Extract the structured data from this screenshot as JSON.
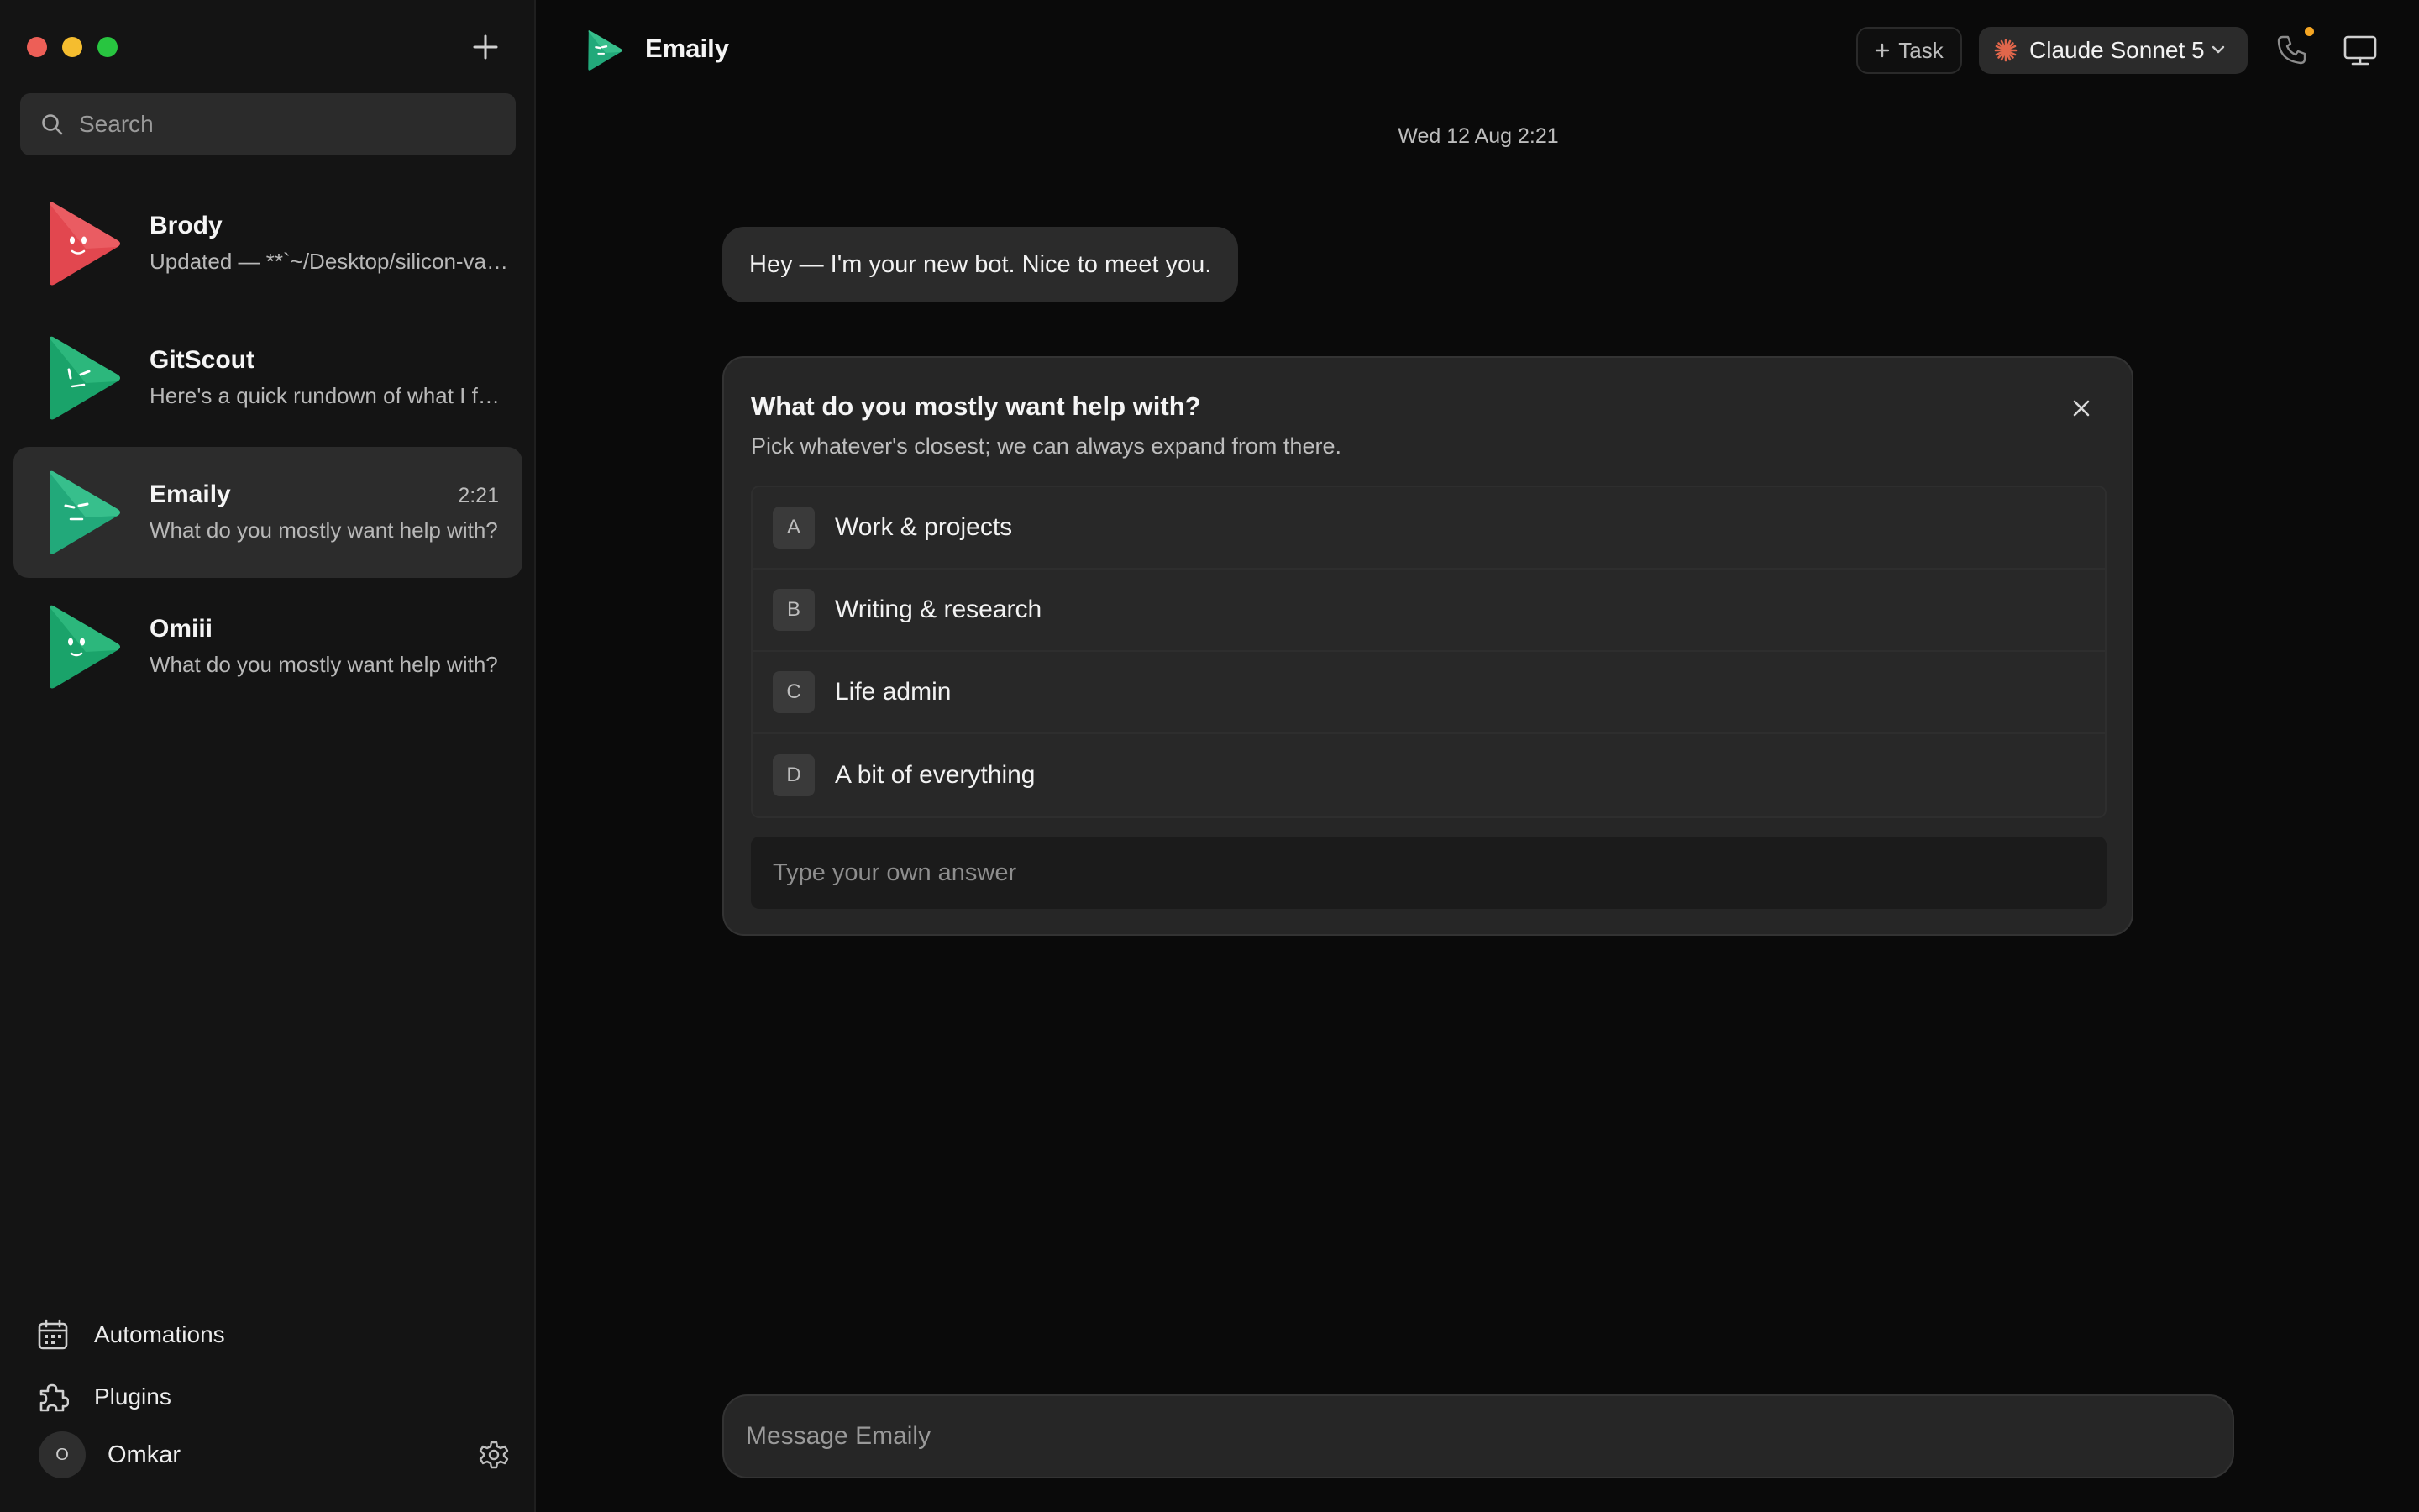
{
  "sidebar": {
    "search_placeholder": "Search",
    "chats": [
      {
        "name": "Brody",
        "preview": "Updated — **`~/Desktop/silicon-valley-sim/index.html`**",
        "time": "",
        "color": "#e2474f"
      },
      {
        "name": "GitScout",
        "preview": "Here's a quick rundown of what I found in the repo",
        "time": "",
        "color": "#1aa36a"
      },
      {
        "name": "Emaily",
        "preview": "What do you mostly want help with?",
        "time": "2:21",
        "color": "#22a97a"
      },
      {
        "name": "Omiii",
        "preview": "What do you mostly want help with?",
        "time": "",
        "color": "#1aa36a"
      }
    ],
    "nav": {
      "automations": "Automations",
      "plugins": "Plugins"
    },
    "user": {
      "initial": "O",
      "name": "Omkar"
    }
  },
  "header": {
    "title": "Emaily",
    "task_label": "Task",
    "model_label": "Claude Sonnet 5",
    "accent": "#f5a623"
  },
  "conversation": {
    "date": "Wed 12 Aug 2:21",
    "bot_message": "Hey — I'm your new bot. Nice to meet you.",
    "question": {
      "title": "What do you mostly want help with?",
      "subtitle": "Pick whatever's closest; we can always expand from there.",
      "options": [
        {
          "key": "A",
          "label": "Work & projects"
        },
        {
          "key": "B",
          "label": "Writing & research"
        },
        {
          "key": "C",
          "label": "Life admin"
        },
        {
          "key": "D",
          "label": "A bit of everything"
        }
      ],
      "own_answer_placeholder": "Type your own answer"
    }
  },
  "composer": {
    "placeholder": "Message Emaily"
  }
}
